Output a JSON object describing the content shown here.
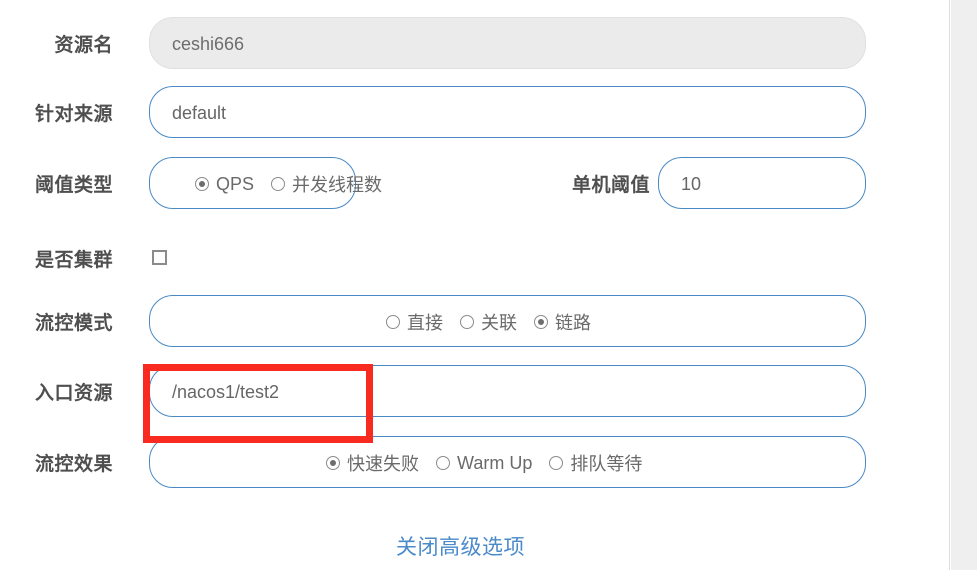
{
  "form": {
    "rows": [
      {
        "label": "资源名",
        "value": "ceshi666",
        "state": "disabled"
      },
      {
        "label": "针对来源",
        "value": "default",
        "state": "enabled"
      },
      {
        "label": "阈值类型",
        "options": [
          {
            "label": "QPS",
            "checked": true
          },
          {
            "label": "并发线程数",
            "checked": false
          }
        ]
      },
      {
        "label": "是否集群",
        "checked": false
      },
      {
        "label": "流控模式",
        "options": [
          {
            "label": "直接",
            "checked": false
          },
          {
            "label": "关联",
            "checked": false
          },
          {
            "label": "链路",
            "checked": true
          }
        ]
      },
      {
        "label": "入口资源",
        "value": "/nacos1/test2",
        "state": "enabled"
      },
      {
        "label": "流控效果",
        "options": [
          {
            "label": "快速失败",
            "checked": true
          },
          {
            "label": "Warm Up",
            "checked": false
          },
          {
            "label": "排队等待",
            "checked": false
          }
        ]
      }
    ],
    "threshold": {
      "label": "单机阈值",
      "value": "10"
    },
    "advanced_toggle": "关闭高级选项"
  },
  "annotation": {
    "name": "entrance-resource-highlight",
    "color": "#f92a20"
  },
  "colors": {
    "field_border": "#4a89c4",
    "link": "#4a8ac9",
    "label": "#4f4f4f",
    "disabled_bg": "#ebebeb",
    "annotation": "#f92a20"
  }
}
